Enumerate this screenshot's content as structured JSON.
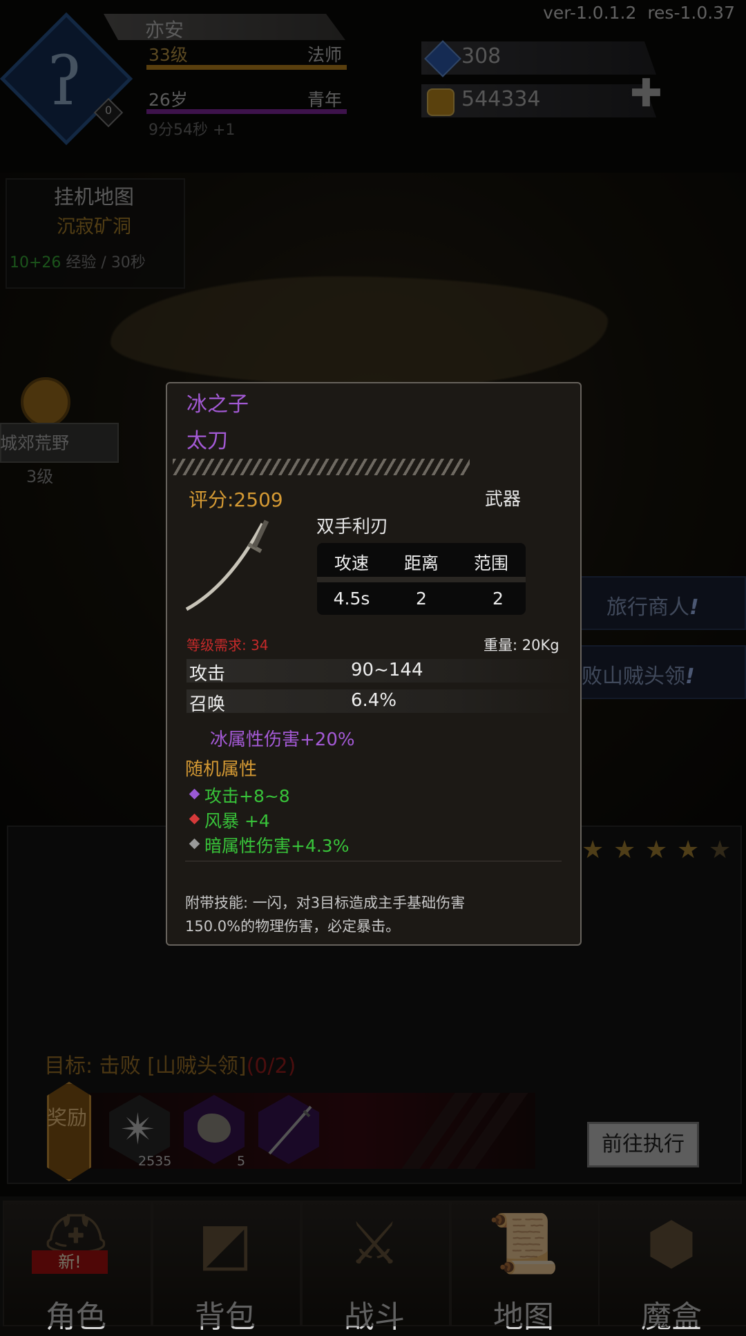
{
  "version": {
    "ver": "ver-1.0.1.2",
    "res": "res-1.0.37"
  },
  "player": {
    "name": "亦安",
    "level": "33级",
    "class": "法师",
    "age": "26岁",
    "stage": "青年",
    "timer": "9分54秒 +1",
    "avatar_badge": "0"
  },
  "currency": {
    "gems": "308",
    "gold": "544334"
  },
  "idle_map": {
    "title": "挂机地图",
    "name": "沉寂矿洞",
    "rate_green": "10+26",
    "rate_rest": " 经验 / 30秒"
  },
  "side_location": {
    "name": "城郊荒野",
    "level": "3级"
  },
  "quests": [
    {
      "label": "旅行商人",
      "mark": "!"
    },
    {
      "label": "败山贼头领",
      "mark": "!"
    }
  ],
  "task": {
    "stars": [
      "★",
      "★",
      "★",
      "★",
      "★"
    ],
    "target_prefix": "目标: 击败 [山贼头领]",
    "target_progress": "(0/2)",
    "reward_label": "奖励",
    "rewards": [
      {
        "icon": "compass-star-icon",
        "count": "2535"
      },
      {
        "icon": "ore-icon",
        "count": "5"
      },
      {
        "icon": "katana-icon",
        "count": ""
      }
    ],
    "go_button": "前往执行"
  },
  "nav": [
    {
      "label": "角色",
      "icon": "helmet-icon",
      "badge": "新!"
    },
    {
      "label": "背包",
      "icon": "backpack-icon"
    },
    {
      "label": "战斗",
      "icon": "sword-shield-icon"
    },
    {
      "label": "地图",
      "icon": "scroll-icon"
    },
    {
      "label": "魔盒",
      "icon": "magic-box-icon"
    }
  ],
  "tooltip": {
    "name": "冰之子",
    "type": "太刀",
    "score": "评分:2509",
    "slot": "武器",
    "subtype": "双手利刃",
    "stats_headers": [
      "攻速",
      "距离",
      "范围"
    ],
    "stats_values": [
      "4.5s",
      "2",
      "2"
    ],
    "requirement": "等级需求: 34",
    "weight": "重量: 20Kg",
    "attributes": [
      {
        "label": "攻击",
        "value": "90~144"
      },
      {
        "label": "召唤",
        "value": "6.4%"
      }
    ],
    "special": "冰属性伤害+20%",
    "random_header": "随机属性",
    "random": [
      {
        "text": "攻击+8~8",
        "gem_color": "#9b5ad6"
      },
      {
        "text": "风暴 +4",
        "gem_color": "#d63a3a"
      },
      {
        "text": "暗属性伤害+4.3%",
        "gem_color": "#9a9a9a"
      }
    ],
    "skill_line1": "附带技能: 一闪，对3目标造成主手基础伤害",
    "skill_line2": "150.0%的物理伤害，必定暴击。"
  }
}
